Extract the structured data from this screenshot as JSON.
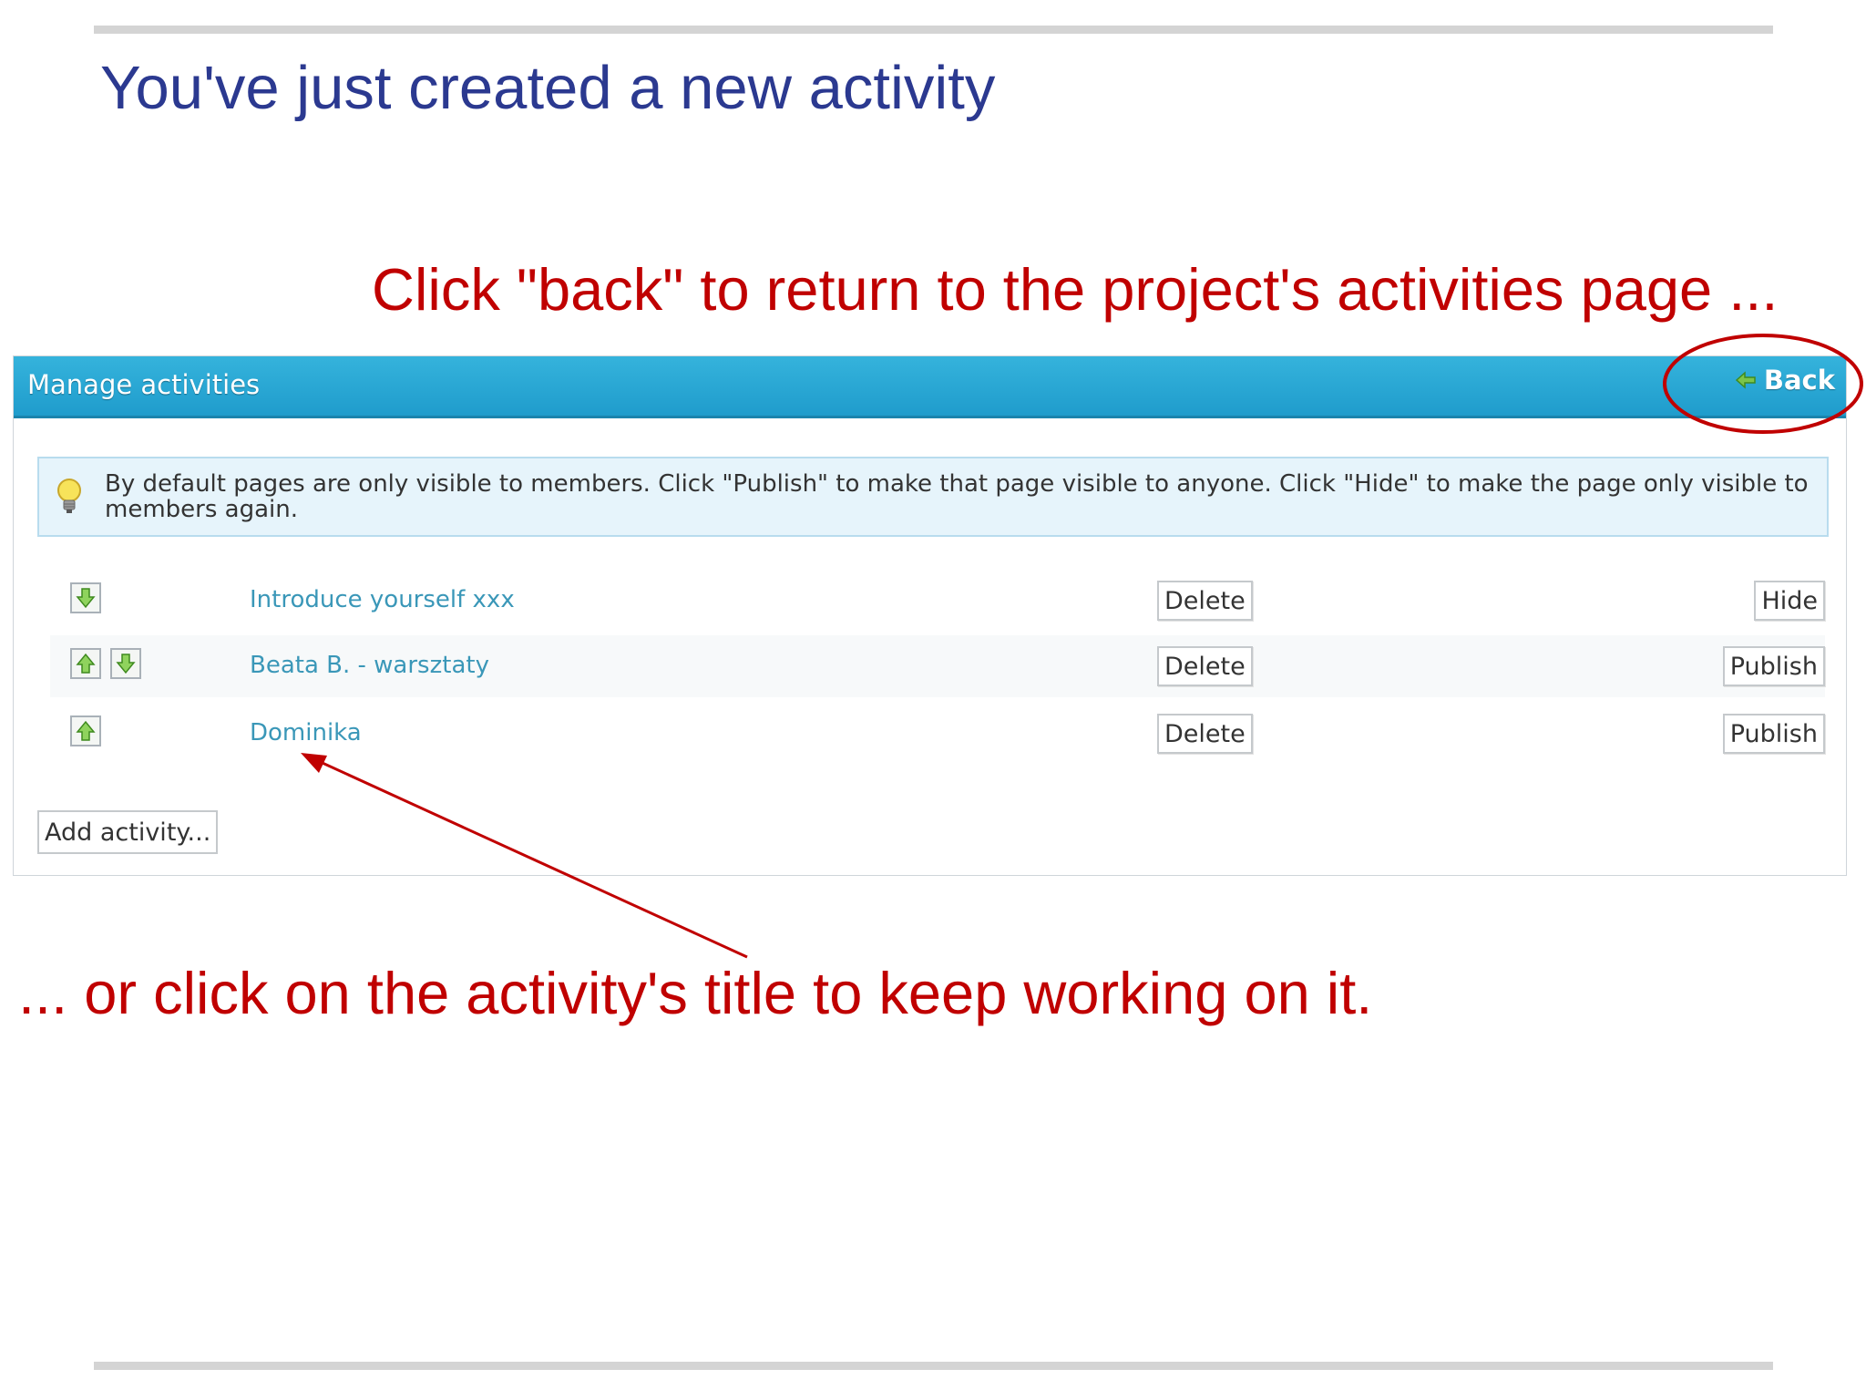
{
  "slide": {
    "title": "You've just created a new activity",
    "callout_back": "Click \"back\" to return to the project's activities page ...",
    "callout_title": "... or click on the activity's title to keep working on it."
  },
  "panel": {
    "title": "Manage activities",
    "back_label": "Back",
    "info_text": "By default pages are only visible to members. Click \"Publish\" to make that page visible to anyone. Click \"Hide\" to make the page only visible to members again.",
    "add_label": "Add activity..."
  },
  "activities": [
    {
      "title": "Introduce yourself xxx",
      "delete_label": "Delete",
      "action_label": "Hide"
    },
    {
      "title": "Beata B. - warsztaty",
      "delete_label": "Delete",
      "action_label": "Publish"
    },
    {
      "title": "Dominika",
      "delete_label": "Delete",
      "action_label": "Publish"
    }
  ],
  "colors": {
    "title_blue": "#2b3990",
    "callout_red": "#c00000",
    "header_blue": "#2aa8d6",
    "link_blue": "#3a97b8"
  },
  "icons": {
    "back": "green-left-arrow-icon",
    "info": "lightbulb-icon",
    "move_up": "green-up-arrow-icon",
    "move_down": "green-down-arrow-icon"
  }
}
